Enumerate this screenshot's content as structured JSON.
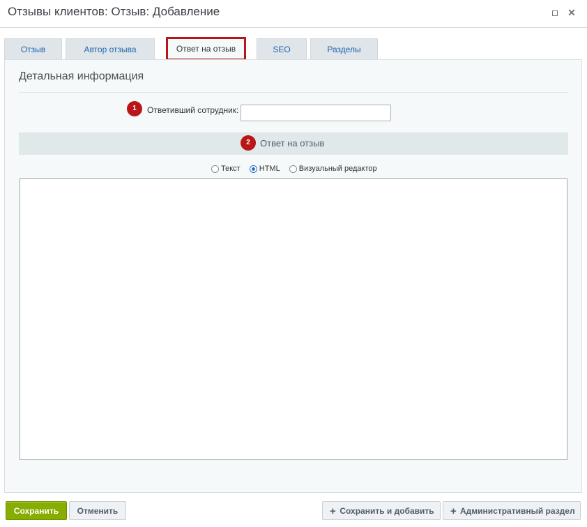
{
  "window": {
    "title": "Отзывы клиентов: Отзыв: Добавление",
    "maximize_icon": "maximize-icon",
    "close_icon": "close-icon"
  },
  "tabs": [
    {
      "label": "Отзыв",
      "active": false
    },
    {
      "label": "Автор отзыва",
      "active": false
    },
    {
      "label": "Ответ на отзыв",
      "active": true
    },
    {
      "label": "SEO",
      "active": false
    },
    {
      "label": "Разделы",
      "active": false
    }
  ],
  "section": {
    "title": "Детальная информация"
  },
  "form": {
    "responder": {
      "badge": "1",
      "label": "Ответивший сотрудник:",
      "value": ""
    },
    "reply_group": {
      "badge": "2",
      "label": "Ответ на отзыв"
    },
    "editor_modes": {
      "options": [
        "Текст",
        "HTML",
        "Визуальный редактор"
      ],
      "selected": "HTML"
    },
    "reply_text": ""
  },
  "footer": {
    "save_label": "Сохранить",
    "cancel_label": "Отменить",
    "save_add_label": "Сохранить и добавить",
    "admin_label": "Административный раздел"
  },
  "colors": {
    "accent_green": "#86ad00",
    "highlight_red": "#b81617",
    "link_blue": "#2067b0",
    "panel_bg": "#f5f9f9"
  }
}
